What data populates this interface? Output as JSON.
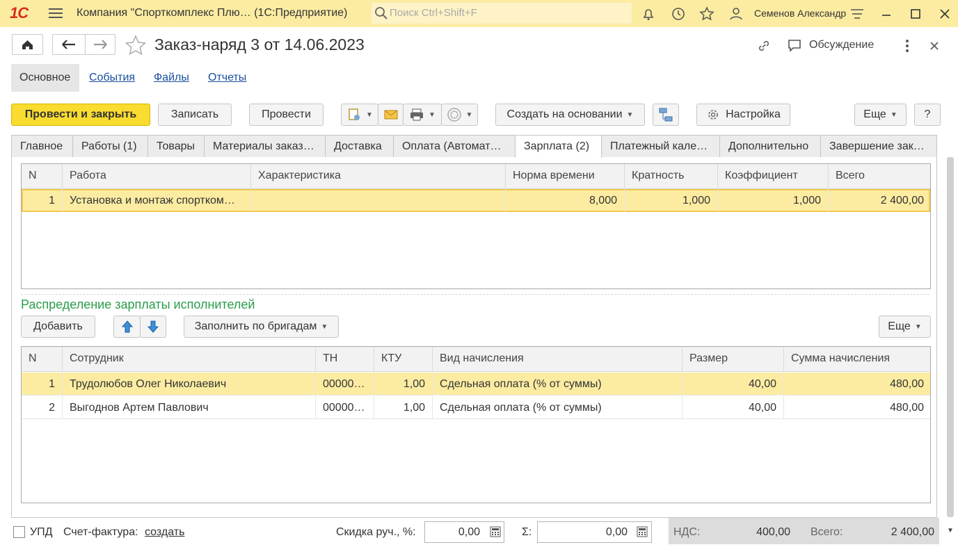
{
  "app": {
    "logo": "1С",
    "title": "Компания \"Спорткомплекс Плю…  (1С:Предприятие)",
    "search_placeholder": "Поиск Ctrl+Shift+F",
    "user": "Семенов Александр"
  },
  "document": {
    "title": "Заказ-наряд 3 от 14.06.2023",
    "discussion": "Обсуждение"
  },
  "nav_tabs": [
    "Основное",
    "События",
    "Файлы",
    "Отчеты"
  ],
  "commands": {
    "post_close": "Провести и закрыть",
    "save": "Записать",
    "post": "Провести",
    "create_based": "Создать на основании",
    "settings": "Настройка",
    "more": "Еще",
    "help": "?"
  },
  "form_tabs": [
    "Главное",
    "Работы (1)",
    "Товары",
    "Материалы заказ…",
    "Доставка",
    "Оплата (Автомат…",
    "Зарплата (2)",
    "Платежный кале…",
    "Дополнительно",
    "Завершение зак…"
  ],
  "works_table": {
    "headers": [
      "N",
      "Работа",
      "Характеристика",
      "Норма времени",
      "Кратность",
      "Коэффициент",
      "Всего"
    ],
    "rows": [
      [
        "1",
        "Установка и монтаж спортком…",
        "",
        "8,000",
        "1,000",
        "1,000",
        "2 400,00"
      ]
    ]
  },
  "distribution": {
    "title": "Распределение зарплаты исполнителей",
    "add": "Добавить",
    "fill_by_teams": "Заполнить по бригадам",
    "more": "Еще",
    "headers": [
      "N",
      "Сотрудник",
      "ТН",
      "КТУ",
      "Вид начисления",
      "Размер",
      "Сумма начисления"
    ],
    "rows": [
      [
        "1",
        "Трудолюбов Олег Николаевич",
        "00000…",
        "1,00",
        "Сдельная оплата (% от суммы)",
        "40,00",
        "480,00"
      ],
      [
        "2",
        "Выгоднов Артем Павлович",
        "00000…",
        "1,00",
        "Сдельная оплата (% от суммы)",
        "40,00",
        "480,00"
      ]
    ]
  },
  "footer": {
    "upd": "УПД",
    "invoice_label": "Счет-фактура:",
    "invoice_link": "создать",
    "discount_label": "Скидка руч., %:",
    "discount_value": "0,00",
    "sum_label": "Σ:",
    "sum_value": "0,00",
    "vat_label": "НДС:",
    "vat_value": "400,00",
    "total_label": "Всего:",
    "total_value": "2 400,00"
  }
}
